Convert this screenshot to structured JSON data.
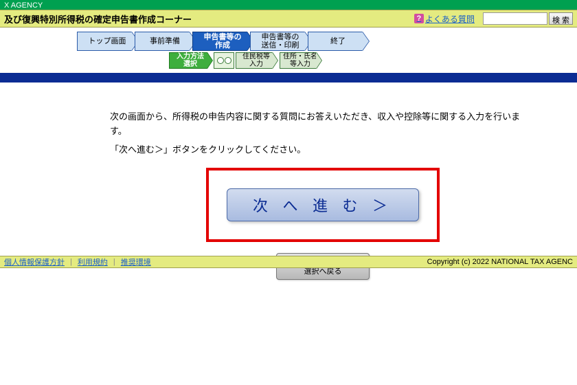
{
  "agency": "X AGENCY",
  "header": {
    "title": "及び復興特別所得税の確定申告書作成コーナー",
    "faq_label": "よくある質問",
    "search_label": "検 索"
  },
  "nav": {
    "steps": [
      "トップ画面",
      "事前準備",
      "申告書等の\n作成",
      "申告書等の\n送信・印刷",
      "終了"
    ],
    "active_index": 2,
    "sub": {
      "active": "入力方法\n選択",
      "items": [
        "住民税等\n入力",
        "住所・氏名\n等入力"
      ]
    }
  },
  "content": {
    "line1": "次の画面から、所得税の申告内容に関する質問にお答えいただき、収入や控除等に関する入力を行います。",
    "line2": "「次へ進む＞」ボタンをクリックしてください。",
    "next_button": "次 へ 進 む ＞",
    "back_button": "＜作成する申告書等の\n選択へ戻る"
  },
  "footer": {
    "links": [
      "個人情報保護方針",
      "利用規約",
      "推奨環境"
    ],
    "copyright": "Copyright (c) 2022 NATIONAL TAX AGENC"
  }
}
